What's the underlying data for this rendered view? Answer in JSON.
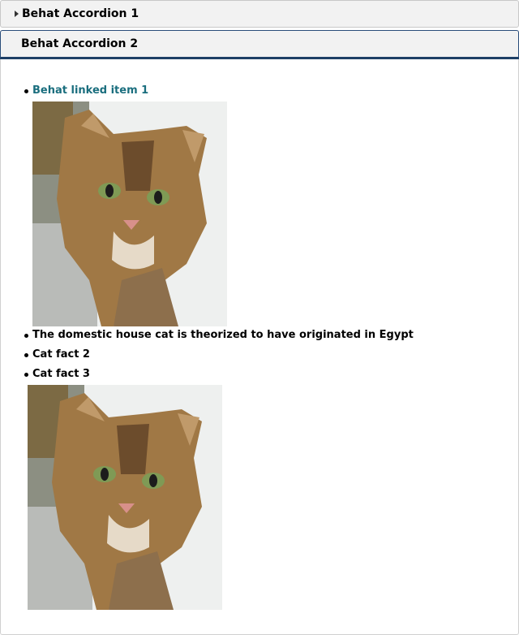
{
  "accordion": {
    "section1_title": "Behat Accordion 1",
    "section2_title": "Behat Accordion 2"
  },
  "list": {
    "item1_link": "Behat linked item 1",
    "item2": "The domestic house cat is theorized to have originated in Egypt",
    "item3": "Cat fact 2",
    "item4": "Cat fact 3"
  },
  "colors": {
    "link": "#1a6e7e",
    "active_header_border": "#1e3f66"
  }
}
